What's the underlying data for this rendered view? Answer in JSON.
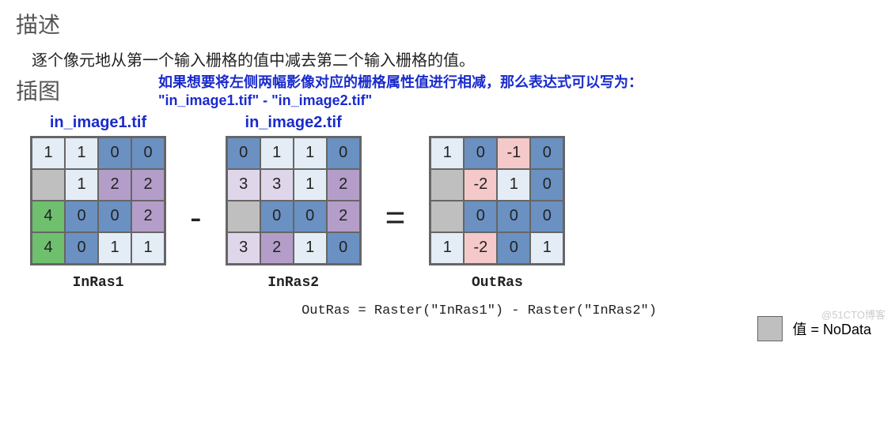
{
  "headings": {
    "desc": "描述",
    "illu": "插图"
  },
  "description": "逐个像元地从第一个输入栅格的值中减去第二个输入栅格的值。",
  "annotation": {
    "line1": "如果想要将左侧两幅影像对应的栅格属性值进行相减，那么表达式可以写为：",
    "line2": "\"in_image1.tif\" - \"in_image2.tif\""
  },
  "rasters": {
    "r1": {
      "title": "in_image1.tif",
      "label": "InRas1",
      "cells": [
        [
          {
            "v": "1",
            "c": "#e4ecf5"
          },
          {
            "v": "1",
            "c": "#e4ecf5"
          },
          {
            "v": "0",
            "c": "#6a91c1"
          },
          {
            "v": "0",
            "c": "#6a91c1"
          }
        ],
        [
          {
            "v": "",
            "c": "#bfbfbf"
          },
          {
            "v": "1",
            "c": "#e4ecf5"
          },
          {
            "v": "2",
            "c": "#b49ec9"
          },
          {
            "v": "2",
            "c": "#b49ec9"
          }
        ],
        [
          {
            "v": "4",
            "c": "#6ec06e"
          },
          {
            "v": "0",
            "c": "#6a91c1"
          },
          {
            "v": "0",
            "c": "#6a91c1"
          },
          {
            "v": "2",
            "c": "#b49ec9"
          }
        ],
        [
          {
            "v": "4",
            "c": "#6ec06e"
          },
          {
            "v": "0",
            "c": "#6a91c1"
          },
          {
            "v": "1",
            "c": "#e4ecf5"
          },
          {
            "v": "1",
            "c": "#e4ecf5"
          }
        ]
      ]
    },
    "r2": {
      "title": "in_image2.tif",
      "label": "InRas2",
      "cells": [
        [
          {
            "v": "0",
            "c": "#6a91c1"
          },
          {
            "v": "1",
            "c": "#e4ecf5"
          },
          {
            "v": "1",
            "c": "#e4ecf5"
          },
          {
            "v": "0",
            "c": "#6a91c1"
          }
        ],
        [
          {
            "v": "3",
            "c": "#e0d6ea"
          },
          {
            "v": "3",
            "c": "#e0d6ea"
          },
          {
            "v": "1",
            "c": "#e4ecf5"
          },
          {
            "v": "2",
            "c": "#b49ec9"
          }
        ],
        [
          {
            "v": "",
            "c": "#bfbfbf"
          },
          {
            "v": "0",
            "c": "#6a91c1"
          },
          {
            "v": "0",
            "c": "#6a91c1"
          },
          {
            "v": "2",
            "c": "#b49ec9"
          }
        ],
        [
          {
            "v": "3",
            "c": "#e0d6ea"
          },
          {
            "v": "2",
            "c": "#b49ec9"
          },
          {
            "v": "1",
            "c": "#e4ecf5"
          },
          {
            "v": "0",
            "c": "#6a91c1"
          }
        ]
      ]
    },
    "out": {
      "label": "OutRas",
      "cells": [
        [
          {
            "v": "1",
            "c": "#e4ecf5"
          },
          {
            "v": "0",
            "c": "#6a91c1"
          },
          {
            "v": "-1",
            "c": "#f5c9c9"
          },
          {
            "v": "0",
            "c": "#6a91c1"
          }
        ],
        [
          {
            "v": "",
            "c": "#bfbfbf"
          },
          {
            "v": "-2",
            "c": "#f5c9c9"
          },
          {
            "v": "1",
            "c": "#e4ecf5"
          },
          {
            "v": "0",
            "c": "#6a91c1"
          }
        ],
        [
          {
            "v": "",
            "c": "#bfbfbf"
          },
          {
            "v": "0",
            "c": "#6a91c1"
          },
          {
            "v": "0",
            "c": "#6a91c1"
          },
          {
            "v": "0",
            "c": "#6a91c1"
          }
        ],
        [
          {
            "v": "1",
            "c": "#e4ecf5"
          },
          {
            "v": "-2",
            "c": "#f5c9c9"
          },
          {
            "v": "0",
            "c": "#6a91c1"
          },
          {
            "v": "1",
            "c": "#e4ecf5"
          }
        ]
      ]
    }
  },
  "operators": {
    "minus": "-",
    "equals": "="
  },
  "legend": "值 = NoData",
  "formula": "OutRas = Raster(\"InRas1\") - Raster(\"InRas2\")",
  "watermark": "@51CTO博客"
}
